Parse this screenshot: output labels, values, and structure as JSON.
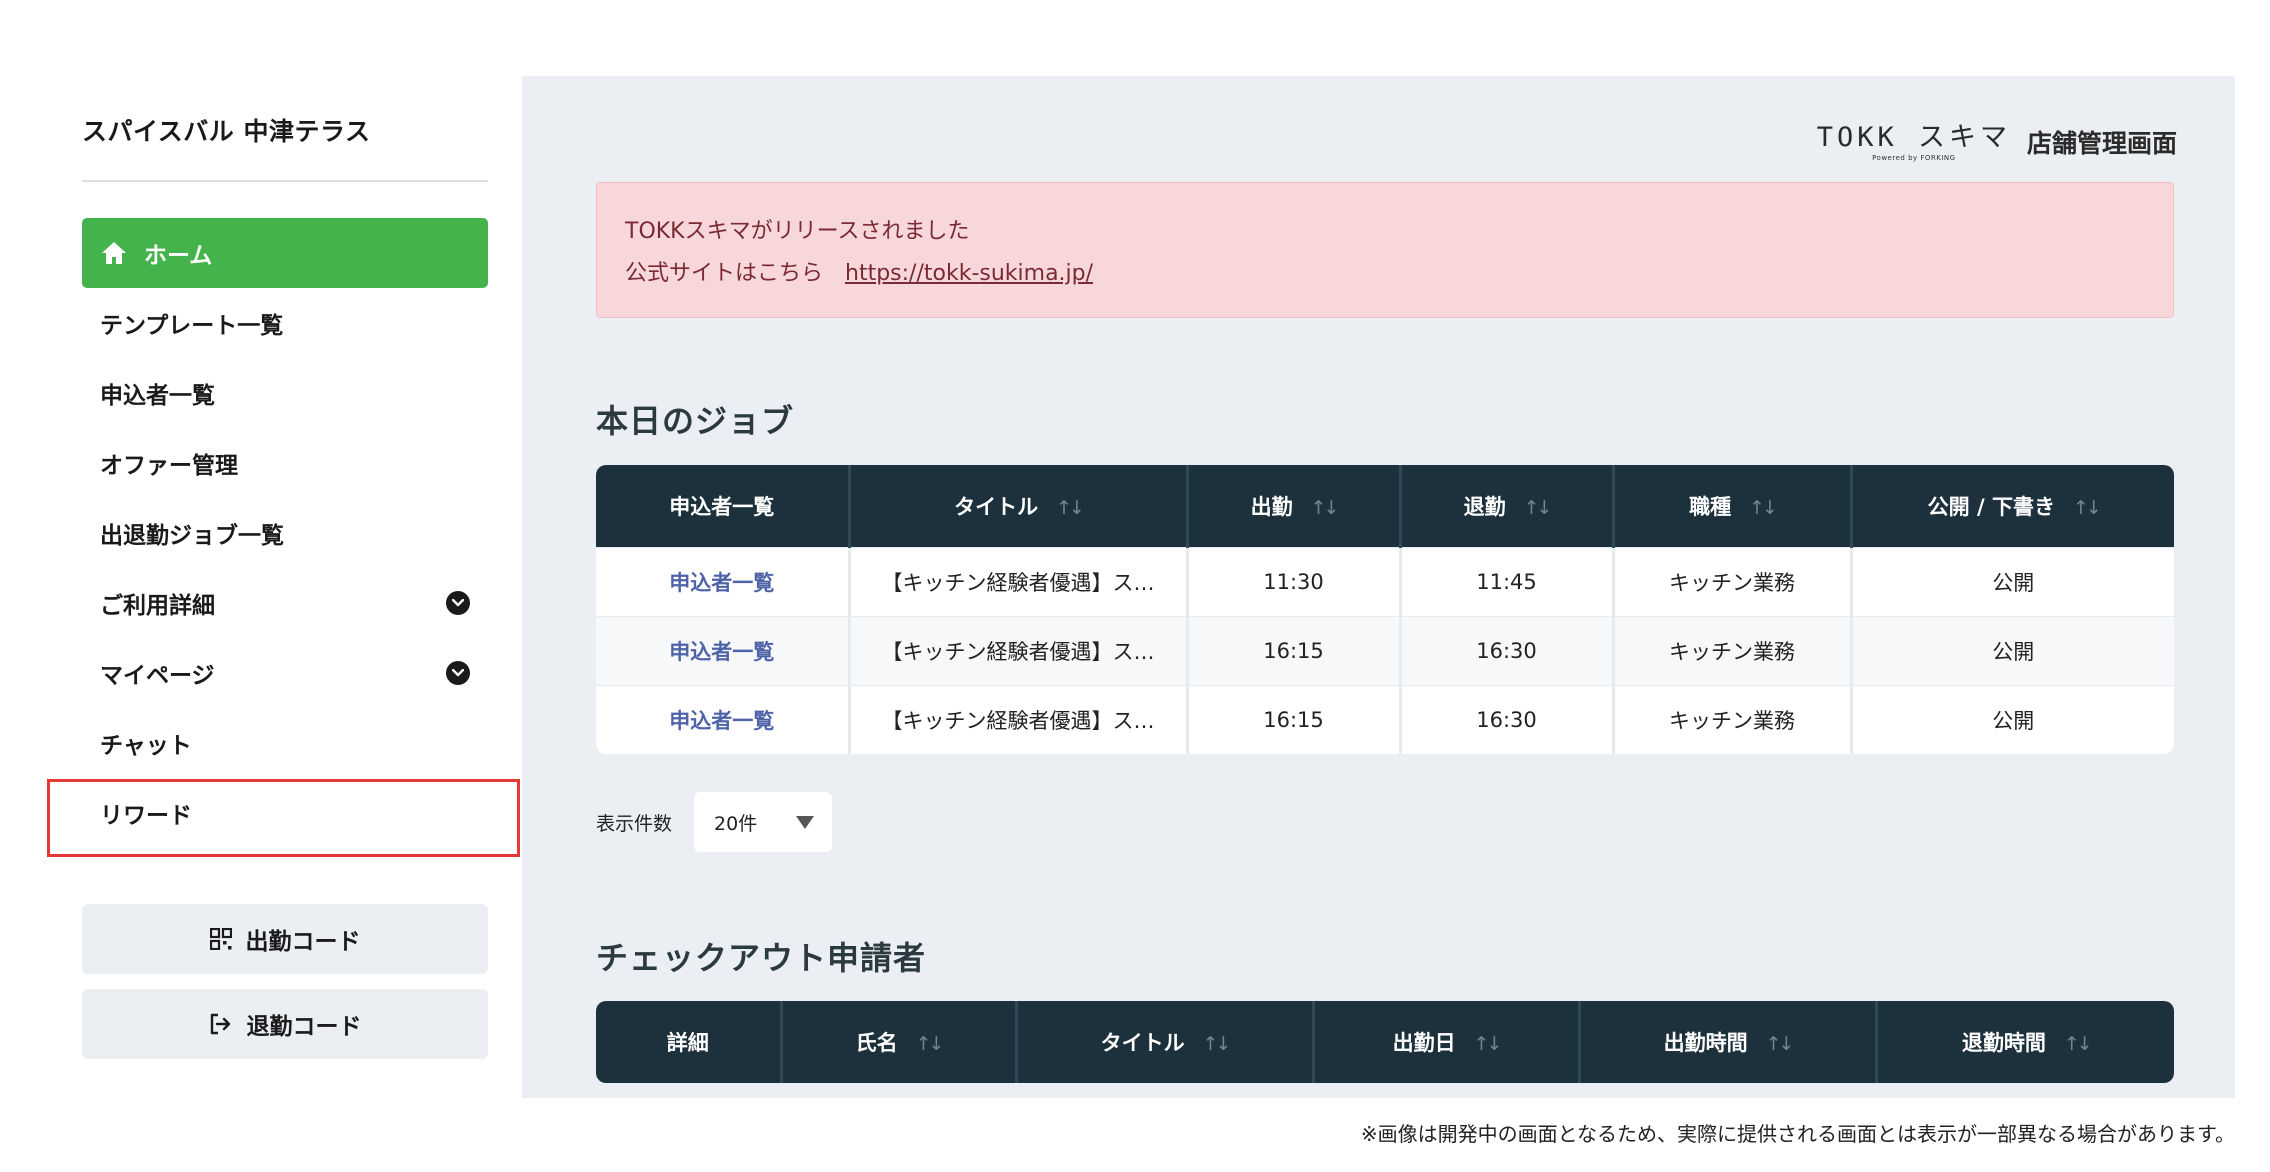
{
  "sidebar": {
    "store_name": "スパイスバル 中津テラス",
    "items": [
      {
        "label": "ホーム"
      },
      {
        "label": "テンプレート一覧"
      },
      {
        "label": "申込者一覧"
      },
      {
        "label": "オファー管理"
      },
      {
        "label": "出退勤ジョブ一覧"
      },
      {
        "label": "ご利用詳細"
      },
      {
        "label": "マイページ"
      },
      {
        "label": "チャット"
      },
      {
        "label": "リワード"
      }
    ],
    "clock_in_button": "出勤コード",
    "clock_out_button": "退勤コード"
  },
  "header": {
    "logo_text": "TOKK スキマ",
    "logo_sub": "Powered by FORKING",
    "label": "店舗管理画面"
  },
  "alert": {
    "line1": "TOKKスキマがリリースされました",
    "line2": "公式サイトはこちら",
    "link": "https://tokk-sukima.jp/"
  },
  "jobs": {
    "title": "本日のジョブ",
    "columns": [
      "申込者一覧",
      "タイトル",
      "出勤",
      "退勤",
      "職種",
      "公開 / 下書き"
    ],
    "rows": [
      [
        "申込者一覧",
        "【キッチン経験者優遇】ス…",
        "11:30",
        "11:45",
        "キッチン業務",
        "公開"
      ],
      [
        "申込者一覧",
        "【キッチン経験者優遇】ス…",
        "16:15",
        "16:30",
        "キッチン業務",
        "公開"
      ],
      [
        "申込者一覧",
        "【キッチン経験者優遇】ス…",
        "16:15",
        "16:30",
        "キッチン業務",
        "公開"
      ]
    ]
  },
  "per_page": {
    "label": "表示件数",
    "value": "20件"
  },
  "checkout": {
    "title": "チェックアウト申請者",
    "columns": [
      "詳細",
      "氏名",
      "タイトル",
      "出勤日",
      "出勤時間",
      "退勤時間"
    ]
  },
  "footnote": "※画像は開発中の画面となるため、実際に提供される画面とは表示が一部異なる場合があります。",
  "colors": {
    "active_nav": "#45b34b",
    "table_header": "#1c313c",
    "alert_bg": "#f8d7db",
    "highlight": "#e53935"
  }
}
